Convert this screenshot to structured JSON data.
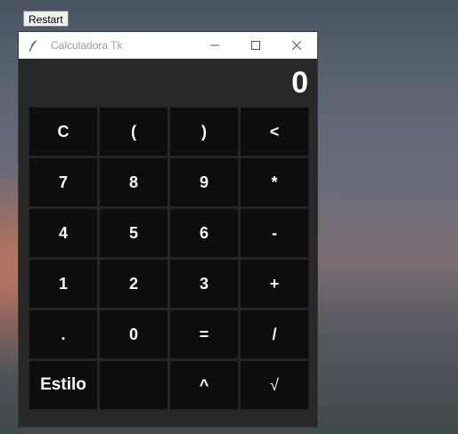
{
  "desktop": {
    "restart_label": "Restart"
  },
  "window": {
    "title": "Calculadora Tk",
    "controls": {
      "minimize": "—",
      "maximize": "☐",
      "close": "✕"
    }
  },
  "display": {
    "value": "0"
  },
  "keys": [
    [
      "C",
      "(",
      ")",
      "<"
    ],
    [
      "7",
      "8",
      "9",
      "*"
    ],
    [
      "4",
      "5",
      "6",
      "-"
    ],
    [
      "1",
      "2",
      "3",
      "+"
    ],
    [
      ".",
      "0",
      "=",
      "/"
    ],
    [
      "Estilo",
      "",
      "^",
      "√"
    ]
  ],
  "colors": {
    "window_bg": "#282828",
    "key_bg": "#0d0d0d",
    "key_text": "#ffffff",
    "titlebar_bg": "#ffffff"
  }
}
